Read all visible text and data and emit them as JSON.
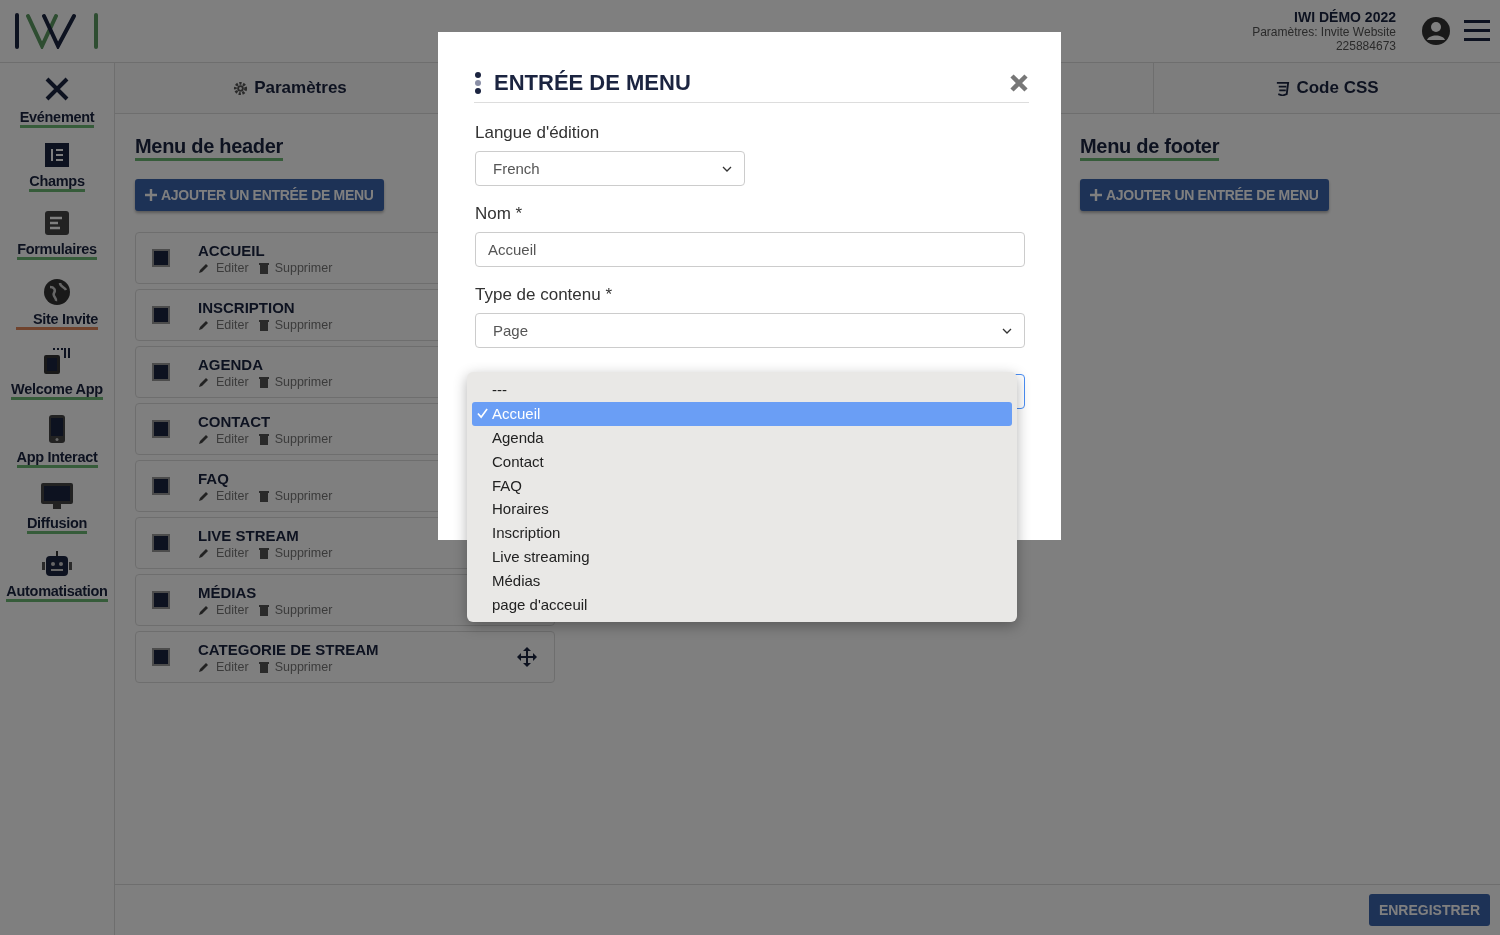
{
  "topbar": {
    "account": {
      "title": "IWI DÉMO 2022",
      "subtitle": "Paramètres: Invite Website",
      "code": "225884673"
    }
  },
  "sidebar": {
    "items": [
      {
        "label": "Evénement",
        "selected": false
      },
      {
        "label": "Champs",
        "selected": false
      },
      {
        "label": "Formulaires",
        "selected": false
      },
      {
        "label": "Site Invite",
        "selected": true
      },
      {
        "label": "Welcome App",
        "selected": false
      },
      {
        "label": "App Interact",
        "selected": false
      },
      {
        "label": "Diffusion",
        "selected": false
      },
      {
        "label": "Automatisation",
        "selected": false
      }
    ]
  },
  "tabs": [
    {
      "label": "Paramètres"
    },
    {
      "label": "Code CSS"
    }
  ],
  "header_menu": {
    "title": "Menu de header",
    "add_button": "AJOUTER UN ENTRÉE DE MENU",
    "items": [
      {
        "name": "ACCUEIL",
        "edit": "Editer",
        "delete": "Supprimer"
      },
      {
        "name": "INSCRIPTION",
        "edit": "Editer",
        "delete": "Supprimer"
      },
      {
        "name": "AGENDA",
        "edit": "Editer",
        "delete": "Supprimer"
      },
      {
        "name": "CONTACT",
        "edit": "Editer",
        "delete": "Supprimer"
      },
      {
        "name": "FAQ",
        "edit": "Editer",
        "delete": "Supprimer"
      },
      {
        "name": "LIVE STREAM",
        "edit": "Editer",
        "delete": "Supprimer"
      },
      {
        "name": "MÉDIAS",
        "edit": "Editer",
        "delete": "Supprimer"
      },
      {
        "name": "CATEGORIE DE STREAM",
        "edit": "Editer",
        "delete": "Supprimer"
      }
    ]
  },
  "footer_menu": {
    "title": "Menu de footer",
    "add_button": "AJOUTER UN ENTRÉE DE MENU"
  },
  "save_button": "ENREGISTRER",
  "modal": {
    "title": "ENTRÉE DE MENU",
    "fields": [
      {
        "label": "Langue d'édition",
        "kind": "select",
        "value": "French"
      },
      {
        "label": "Nom *",
        "kind": "text",
        "value": "Accueil"
      },
      {
        "label": "Type de contenu *",
        "kind": "select",
        "value": "Page"
      }
    ],
    "dropdown": {
      "options": [
        {
          "label": "---",
          "selected": false
        },
        {
          "label": "Accueil",
          "selected": true
        },
        {
          "label": "Agenda",
          "selected": false
        },
        {
          "label": "Contact",
          "selected": false
        },
        {
          "label": "FAQ",
          "selected": false
        },
        {
          "label": "Horaires",
          "selected": false
        },
        {
          "label": "Inscription",
          "selected": false
        },
        {
          "label": "Live streaming",
          "selected": false
        },
        {
          "label": "Médias",
          "selected": false
        },
        {
          "label": "page d'acceuil",
          "selected": false
        }
      ]
    }
  }
}
